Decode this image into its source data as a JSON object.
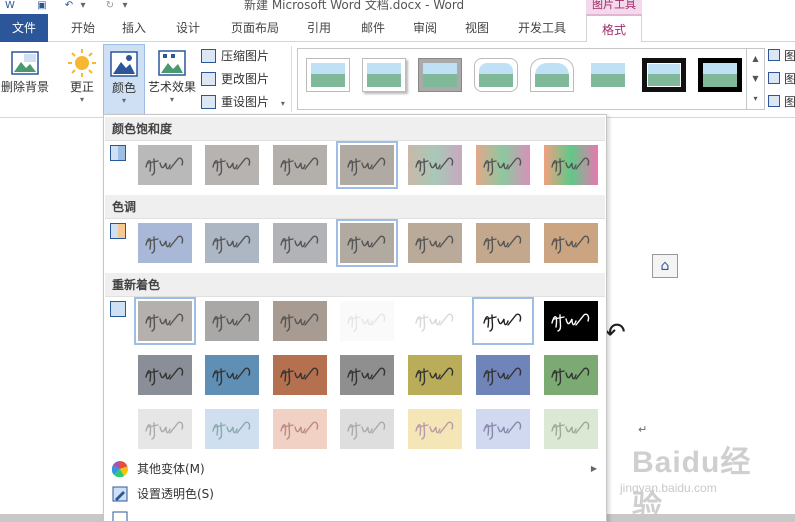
{
  "window": {
    "title": "新建 Microsoft Word 文档.docx - Word",
    "contextual_tab_group": "图片工具"
  },
  "tabs": [
    {
      "label": "文件"
    },
    {
      "label": "开始"
    },
    {
      "label": "插入"
    },
    {
      "label": "设计"
    },
    {
      "label": "页面布局"
    },
    {
      "label": "引用"
    },
    {
      "label": "邮件"
    },
    {
      "label": "审阅"
    },
    {
      "label": "视图"
    },
    {
      "label": "开发工具"
    },
    {
      "label": "格式"
    }
  ],
  "ribbon": {
    "remove_background": "删除背景",
    "corrections": "更正",
    "color": "颜色",
    "artistic_effects": "艺术效果",
    "compress_pictures": "压缩图片",
    "change_picture": "更改图片",
    "reset_picture": "重设图片",
    "picture_border_partial": "图",
    "picture_effects_partial": "图",
    "picture_layout_partial": "图"
  },
  "color_menu": {
    "sections": [
      {
        "title": "颜色饱和度"
      },
      {
        "title": "色调"
      },
      {
        "title": "重新着色"
      }
    ],
    "items": {
      "more_variations": "其他变体(M)",
      "set_transparent": "设置透明色(S)"
    }
  },
  "watermark": {
    "main": "Baidu经验",
    "sub": "jingyan.baidu.com"
  },
  "document": {
    "paragraph_mark": "↵"
  },
  "colors": {
    "accent_file_tab": "#2b579a",
    "accent_format_tab": "#a12b6e",
    "selected_swatch_border": "#9ebee3"
  }
}
